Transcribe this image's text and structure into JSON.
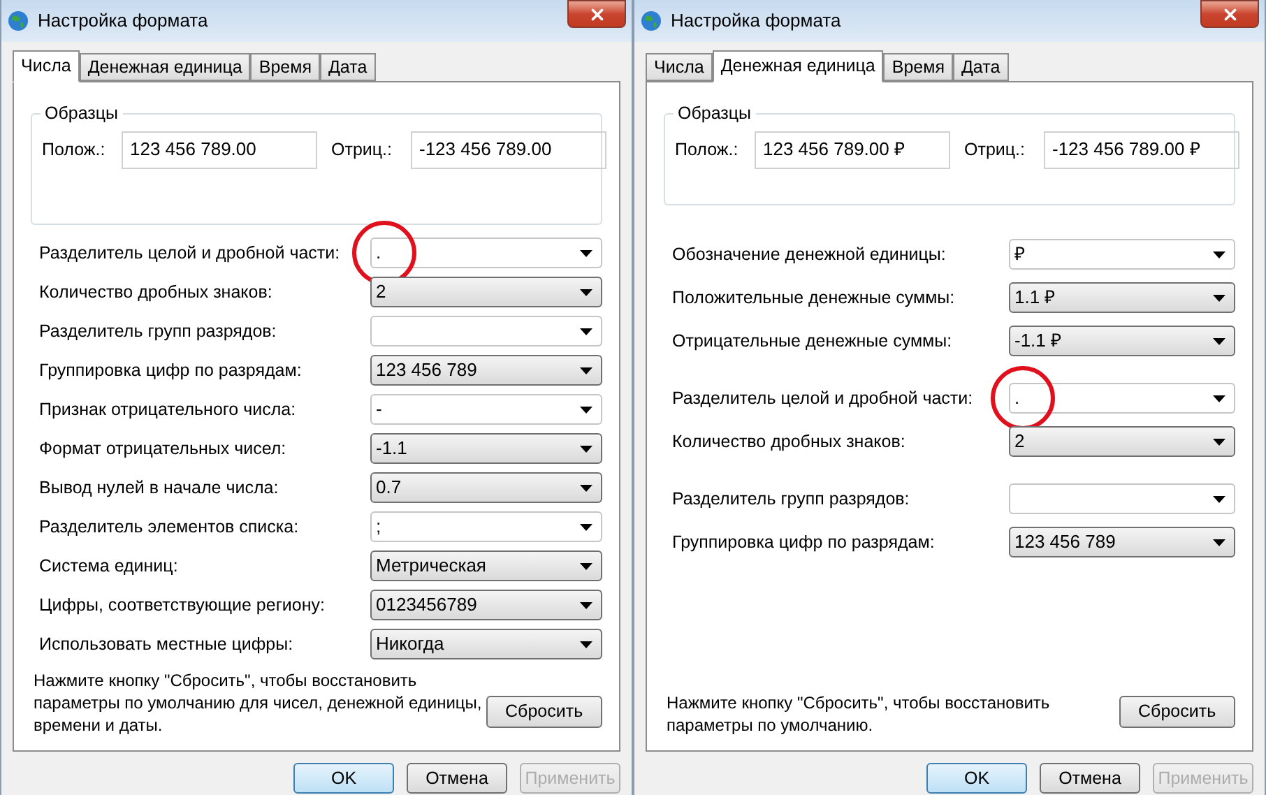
{
  "dialogs": [
    {
      "title": "Настройка формата",
      "tabs": [
        {
          "label": "Числа",
          "selected": true
        },
        {
          "label": "Денежная единица",
          "selected": false
        },
        {
          "label": "Время",
          "selected": false
        },
        {
          "label": "Дата",
          "selected": false
        }
      ],
      "samples": {
        "title": "Образцы",
        "fields": [
          {
            "label": "Полож.:",
            "value": "123 456 789.00"
          },
          {
            "label": "Отриц.:",
            "value": "-123 456 789.00"
          }
        ]
      },
      "setting_groups": [
        {
          "rows": [
            {
              "label": "Разделитель целой и дробной части:",
              "value": ".",
              "kind": "editable",
              "circled": true
            },
            {
              "label": "Количество дробных знаков:",
              "value": "2",
              "kind": "combo",
              "circled": false
            },
            {
              "label": "Разделитель групп разрядов:",
              "value": "",
              "kind": "editable",
              "circled": false
            },
            {
              "label": "Группировка цифр по разрядам:",
              "value": "123 456 789",
              "kind": "combo",
              "circled": false
            },
            {
              "label": "Признак отрицательного числа:",
              "value": "-",
              "kind": "editable",
              "circled": false
            },
            {
              "label": "Формат отрицательных чисел:",
              "value": "-1.1",
              "kind": "combo",
              "circled": false
            },
            {
              "label": "Вывод нулей в начале числа:",
              "value": "0.7",
              "kind": "combo",
              "circled": false
            },
            {
              "label": "Разделитель элементов списка:",
              "value": ";",
              "kind": "editable",
              "circled": false
            },
            {
              "label": "Система единиц:",
              "value": "Метрическая",
              "kind": "combo",
              "circled": false
            },
            {
              "label": "Цифры, соответствующие региону:",
              "value": "0123456789",
              "kind": "combo",
              "circled": false
            },
            {
              "label": "Использовать местные цифры:",
              "value": "Никогда",
              "kind": "combo",
              "circled": false
            }
          ]
        }
      ],
      "note": "Нажмите кнопку \"Сбросить\", чтобы восстановить параметры по умолчанию для чисел, денежной единицы, времени и даты.",
      "reset_button": "Сбросить",
      "buttons": [
        {
          "label": "OK",
          "default": true,
          "disabled": false
        },
        {
          "label": "Отмена",
          "default": false,
          "disabled": false
        },
        {
          "label": "Применить",
          "default": false,
          "disabled": true
        }
      ]
    },
    {
      "title": "Настройка формата",
      "tabs": [
        {
          "label": "Числа",
          "selected": false
        },
        {
          "label": "Денежная единица",
          "selected": true
        },
        {
          "label": "Время",
          "selected": false
        },
        {
          "label": "Дата",
          "selected": false
        }
      ],
      "samples": {
        "title": "Образцы",
        "fields": [
          {
            "label": "Полож.:",
            "value": "123 456 789.00 ₽"
          },
          {
            "label": "Отриц.:",
            "value": "-123 456 789.00 ₽"
          }
        ]
      },
      "setting_groups": [
        {
          "rows": [
            {
              "label": "Обозначение денежной единицы:",
              "value": "₽",
              "kind": "editable",
              "circled": false
            },
            {
              "label": "Положительные денежные суммы:",
              "value": "1.1 ₽",
              "kind": "combo",
              "circled": false
            },
            {
              "label": "Отрицательные денежные суммы:",
              "value": "-1.1 ₽",
              "kind": "combo",
              "circled": false
            }
          ]
        },
        {
          "rows": [
            {
              "label": "Разделитель целой и дробной части:",
              "value": ".",
              "kind": "editable",
              "circled": true
            },
            {
              "label": "Количество дробных знаков:",
              "value": "2",
              "kind": "combo",
              "circled": false
            }
          ]
        },
        {
          "rows": [
            {
              "label": "Разделитель групп разрядов:",
              "value": "",
              "kind": "editable",
              "circled": false
            },
            {
              "label": "Группировка цифр по разрядам:",
              "value": "123 456 789",
              "kind": "combo",
              "circled": false
            }
          ]
        }
      ],
      "note": "Нажмите кнопку \"Сбросить\", чтобы восстановить параметры по умолчанию.",
      "reset_button": "Сбросить",
      "buttons": [
        {
          "label": "OK",
          "default": true,
          "disabled": false
        },
        {
          "label": "Отмена",
          "default": false,
          "disabled": false
        },
        {
          "label": "Применить",
          "default": false,
          "disabled": true
        }
      ]
    }
  ]
}
